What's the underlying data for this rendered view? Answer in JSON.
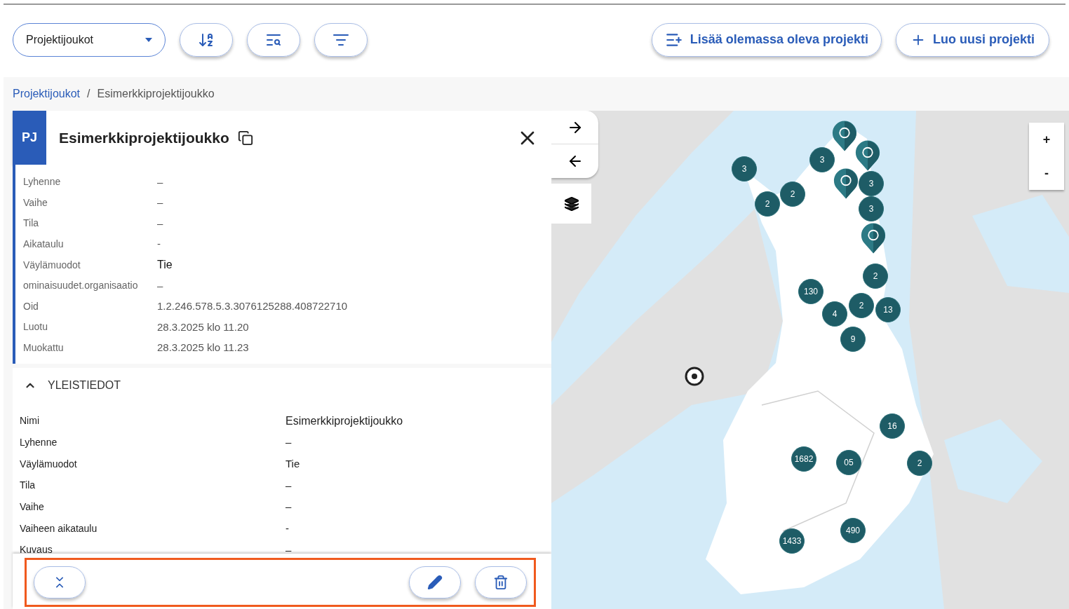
{
  "toolbar": {
    "dropdown": {
      "value": "Projektijoukot"
    },
    "actions": [
      {
        "kind": "add-existing",
        "label": "Lisää olemassa oleva projekti"
      },
      {
        "kind": "create",
        "label": "Luo uusi projekti"
      }
    ]
  },
  "breadcrumb": [
    {
      "kind": "link",
      "label": "Projektijoukot"
    },
    {
      "kind": "separator",
      "label": "/"
    },
    {
      "kind": "current",
      "label": "Esimerkkiprojektijoukko"
    }
  ],
  "panel": {
    "badge": "PJ",
    "title": "Esimerkkiprojektijoukko",
    "meta": [
      {
        "label": "Lyhenne",
        "value": "–"
      },
      {
        "label": "Vaihe",
        "value": "–"
      },
      {
        "label": "Tila",
        "value": "–"
      },
      {
        "label": "Aikataulu",
        "value": "-"
      },
      {
        "label": "Väylämuodot",
        "value": "Tie"
      },
      {
        "label": "ominaisuudet.organisaatio",
        "value": "–"
      },
      {
        "label": "Oid",
        "value": "1.2.246.578.5.3.3076125288.408722710"
      },
      {
        "label": "Luotu",
        "value": "28.3.2025 klo 11.20"
      },
      {
        "label": "Muokattu",
        "value": "28.3.2025 klo 11.23"
      }
    ],
    "section": {
      "title": "YLEISTIEDOT",
      "expanded": true,
      "rows": [
        {
          "label": "Nimi",
          "value": "Esimerkkiprojektijoukko"
        },
        {
          "label": "Lyhenne",
          "value": "–"
        },
        {
          "label": "Väylämuodot",
          "value": "Tie"
        },
        {
          "label": "Tila",
          "value": "–"
        },
        {
          "label": "Vaihe",
          "value": "–"
        },
        {
          "label": "Vaiheen aikataulu",
          "value": "-"
        },
        {
          "label": "Kuvaus",
          "value": "–"
        }
      ]
    }
  },
  "map": {
    "zoom": [
      "+",
      "-"
    ],
    "markers": [
      {
        "kind": "cluster",
        "count": "3"
      },
      {
        "kind": "pin"
      },
      {
        "kind": "cluster",
        "count": "3"
      },
      {
        "kind": "pin"
      },
      {
        "kind": "cluster",
        "count": "2"
      },
      {
        "kind": "cluster",
        "count": "2"
      },
      {
        "kind": "pin"
      },
      {
        "kind": "cluster",
        "count": "3"
      },
      {
        "kind": "cluster",
        "count": "3"
      },
      {
        "kind": "pin"
      },
      {
        "kind": "cluster",
        "count": "2"
      },
      {
        "kind": "cluster",
        "count": "130"
      },
      {
        "kind": "cluster",
        "count": "4"
      },
      {
        "kind": "cluster",
        "count": "2"
      },
      {
        "kind": "cluster",
        "count": "13"
      },
      {
        "kind": "cluster",
        "count": "9"
      },
      {
        "kind": "cluster",
        "count": "16"
      },
      {
        "kind": "cluster",
        "count": "1682"
      },
      {
        "kind": "cluster",
        "count": "05"
      },
      {
        "kind": "cluster",
        "count": "2"
      },
      {
        "kind": "cluster",
        "count": "490"
      },
      {
        "kind": "cluster",
        "count": "1433"
      },
      {
        "kind": "location"
      }
    ]
  }
}
